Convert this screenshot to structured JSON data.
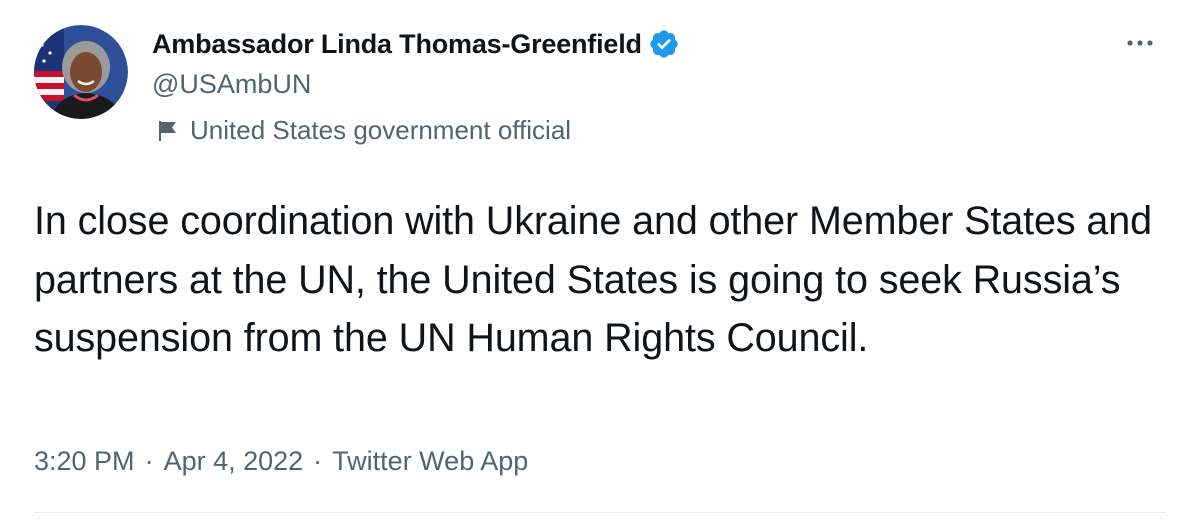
{
  "author": {
    "display_name": "Ambassador Linda Thomas-Greenfield",
    "handle": "@USAmbUN",
    "verified": true,
    "label": "United States government official",
    "avatar_icon": "profile-photo",
    "verified_icon": "verified-badge-icon",
    "label_icon": "flag-icon"
  },
  "tweet": {
    "text": "In close coordination with Ukraine and other Member States and partners at the UN, the United States is going to seek Russia’s suspension from the UN Human Rights Council."
  },
  "meta": {
    "time": "3:20 PM",
    "separator": "·",
    "date": "Apr 4, 2022",
    "source": "Twitter Web App"
  },
  "colors": {
    "text_primary": "#0f1419",
    "text_secondary": "#536471",
    "verified_blue": "#1d9bf0",
    "divider": "#e6ecf0"
  },
  "more_icon": "more-options-icon"
}
